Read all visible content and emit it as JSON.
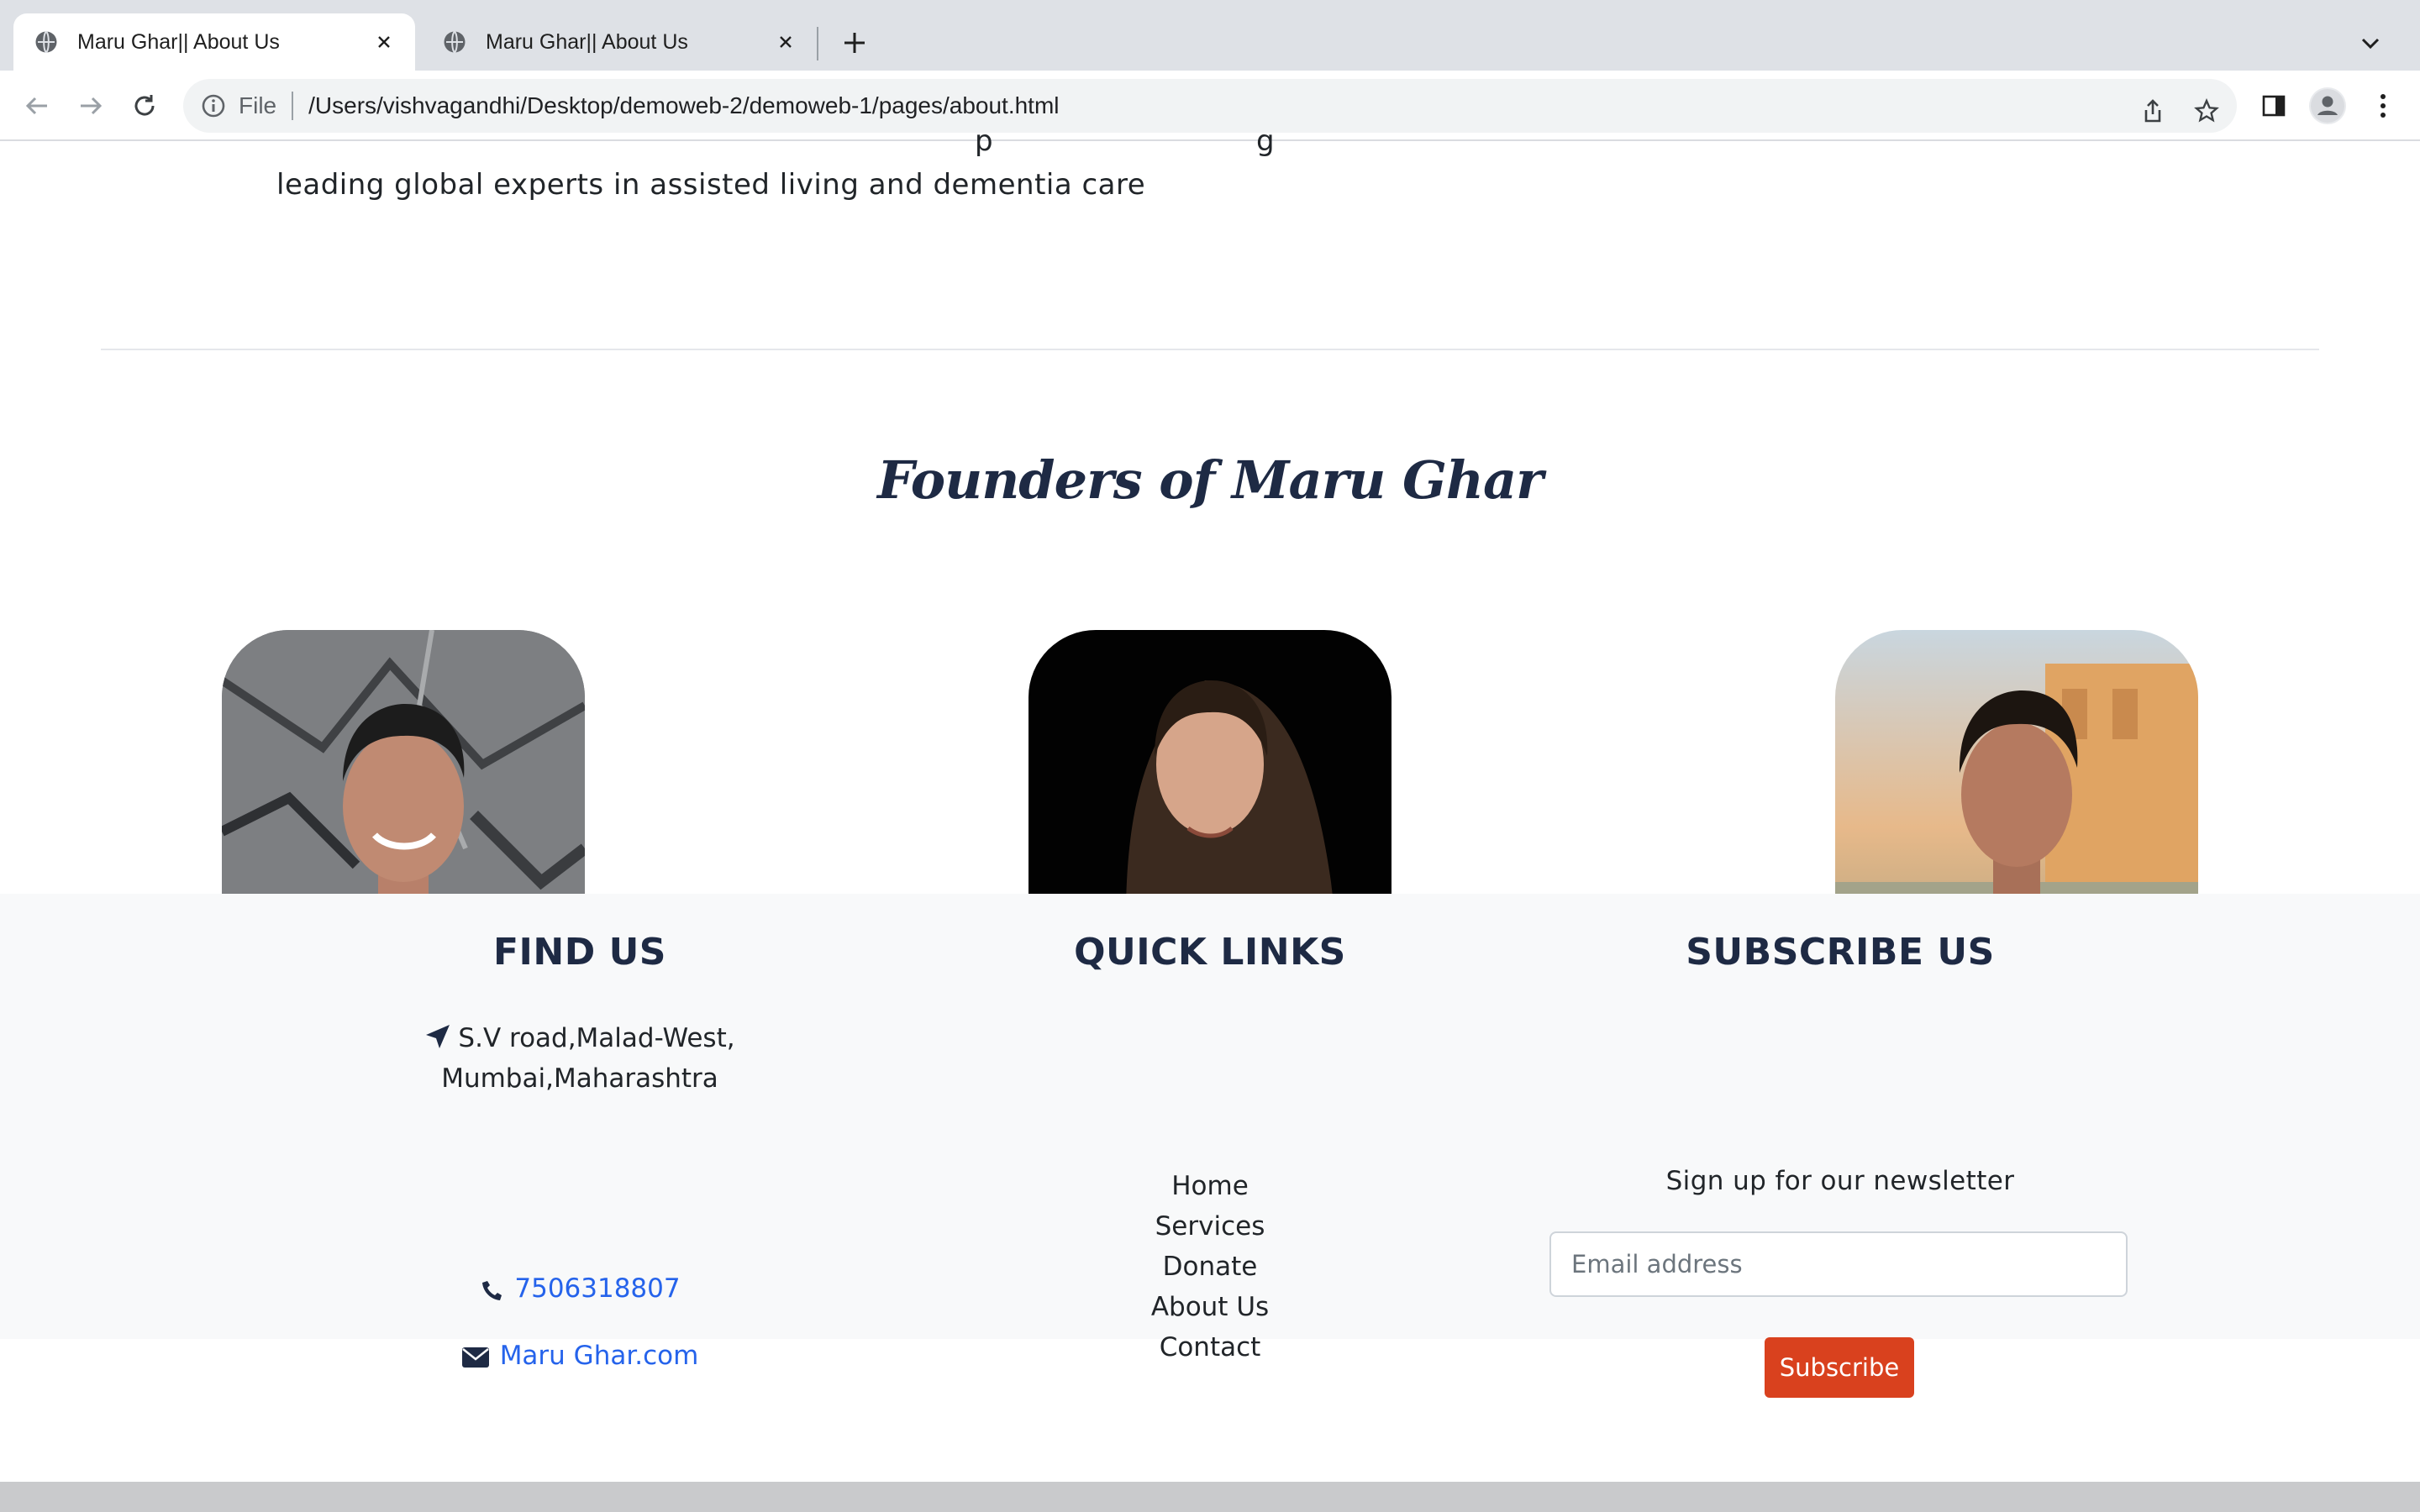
{
  "browser": {
    "tabs": [
      {
        "title": "Maru Ghar|| About Us",
        "active": true
      },
      {
        "title": "Maru Ghar|| About Us",
        "active": false
      }
    ],
    "address": {
      "scheme_label": "File",
      "url": "/Users/vishvagandhi/Desktop/demoweb-2/demoweb-1/pages/about.html"
    }
  },
  "about": {
    "intro_line": "leading global experts in assisted living and dementia care"
  },
  "founders": {
    "title": "Founders of Maru Ghar",
    "members": [
      {
        "photo_alt": "Founder photo 1"
      },
      {
        "photo_alt": "Founder photo 2"
      },
      {
        "photo_alt": "Founder photo 3"
      }
    ]
  },
  "footer": {
    "find_us": {
      "title": "FIND US",
      "address_line1": "S.V road,Malad-West,",
      "address_line2": "Mumbai,Maharashtra",
      "phone": "7506318807",
      "email": "Maru Ghar.com"
    },
    "quick_links": {
      "title": "QUICK LINKS",
      "items": [
        "Home",
        "Services",
        "Donate",
        "About Us",
        "Contact"
      ]
    },
    "subscribe": {
      "title": "SUBSCRIBE US",
      "text": "Sign up for our newsletter",
      "email_placeholder": "Email address",
      "button_label": "Subscribe"
    }
  },
  "colors": {
    "heading": "#1e2a44",
    "link": "#2563eb",
    "subscribe_button": "#d9411e",
    "footer_bg": "#f8f9fa"
  }
}
